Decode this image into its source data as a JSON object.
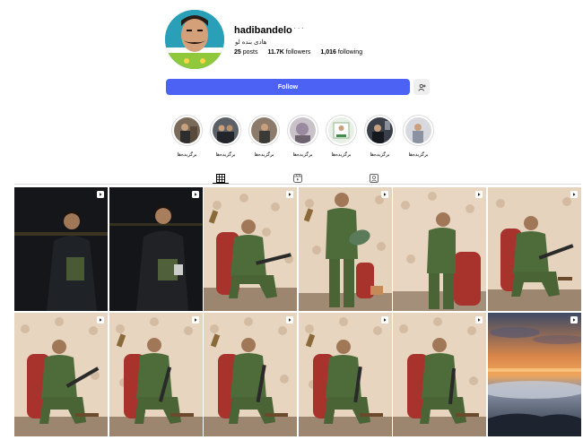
{
  "profile": {
    "username": "hadibandelo",
    "more": "···",
    "full_name": "هادی بنده لو",
    "stats": [
      {
        "count": "25",
        "label": "posts"
      },
      {
        "count": "11.7K",
        "label": "followers"
      },
      {
        "count": "1,016",
        "label": "following"
      }
    ],
    "follow_label": "Follow"
  },
  "highlights": [
    {
      "label": "برگزیده‌ها"
    },
    {
      "label": "برگزیده‌ها"
    },
    {
      "label": "برگزیده‌ها"
    },
    {
      "label": "برگزیده‌ها"
    },
    {
      "label": "برگزیده‌ها"
    },
    {
      "label": "برگزیده‌ها"
    },
    {
      "label": "برگزیده‌ها"
    }
  ],
  "tabs": [
    {
      "name": "posts",
      "icon": "grid-icon",
      "active": true
    },
    {
      "name": "reels",
      "icon": "reels-icon",
      "active": false
    },
    {
      "name": "tagged",
      "icon": "tagged-icon",
      "active": false
    }
  ],
  "posts": [
    {
      "scene": "night-man"
    },
    {
      "scene": "night-man-2"
    },
    {
      "scene": "seated"
    },
    {
      "scene": "standing-guitar"
    },
    {
      "scene": "standing-walk"
    },
    {
      "scene": "seated-rifle"
    },
    {
      "scene": "seated"
    },
    {
      "scene": "seated"
    },
    {
      "scene": "seated"
    },
    {
      "scene": "seated"
    },
    {
      "scene": "seated"
    },
    {
      "scene": "sunset"
    }
  ],
  "colors": {
    "follow_button": "#4c62f4",
    "border": "#dbdbdb",
    "wallpaper": "#e6d3be",
    "uniform": "#4e6b3a",
    "chair": "#a8332d"
  }
}
